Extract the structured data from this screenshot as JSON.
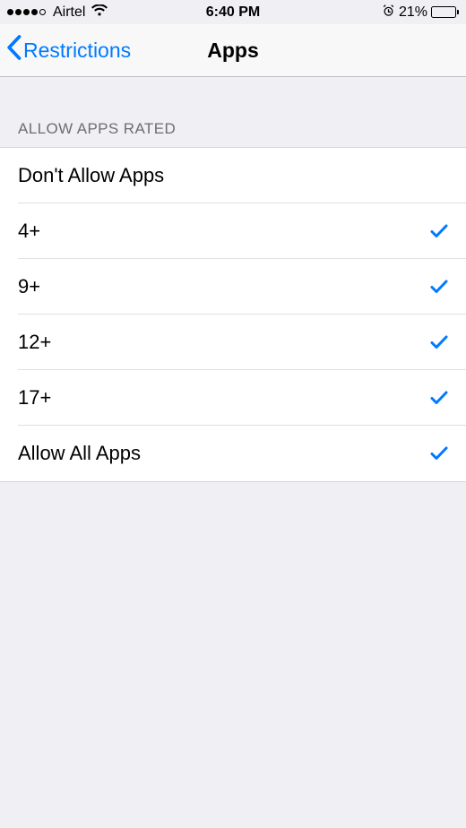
{
  "status_bar": {
    "carrier": "Airtel",
    "time": "6:40 PM",
    "battery_percent": "21%"
  },
  "nav": {
    "back_label": "Restrictions",
    "title": "Apps"
  },
  "section_header": "ALLOW APPS RATED",
  "rows": [
    {
      "label": "Don't Allow Apps",
      "checked": false
    },
    {
      "label": "4+",
      "checked": true
    },
    {
      "label": "9+",
      "checked": true
    },
    {
      "label": "12+",
      "checked": true
    },
    {
      "label": "17+",
      "checked": true
    },
    {
      "label": "Allow All Apps",
      "checked": true
    }
  ]
}
